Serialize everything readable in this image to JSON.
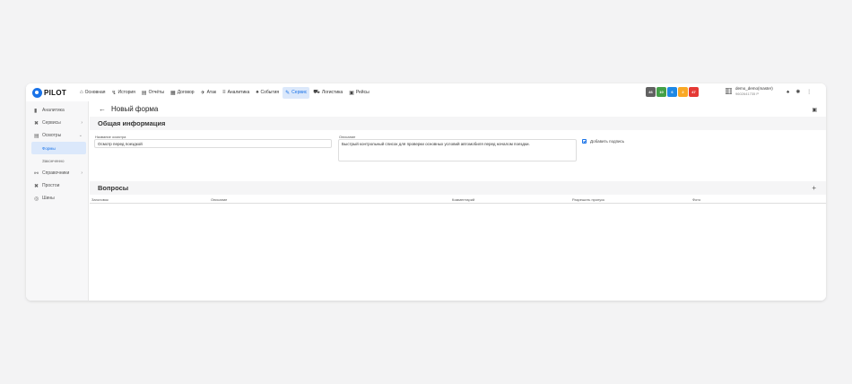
{
  "app": {
    "logo_text": "PILOT"
  },
  "nav": [
    {
      "label": "Основная",
      "icon": "home-icon",
      "glyph": "⌂",
      "active": false
    },
    {
      "label": "История",
      "icon": "history-icon",
      "glyph": "↯",
      "active": false
    },
    {
      "label": "Отчёты",
      "icon": "report-icon",
      "glyph": "▤",
      "active": false
    },
    {
      "label": "Договор",
      "icon": "contract-icon",
      "glyph": "▦",
      "active": false
    },
    {
      "label": "Атак",
      "icon": "attack-icon",
      "glyph": "✈",
      "active": false
    },
    {
      "label": "Аналитика",
      "icon": "analytics-icon",
      "glyph": "≡",
      "active": false
    },
    {
      "label": "События",
      "icon": "bell-icon",
      "glyph": "♠",
      "active": false
    },
    {
      "label": "Сервис",
      "icon": "wrench-icon",
      "glyph": "✎",
      "active": true
    },
    {
      "label": "Логистика",
      "icon": "truck-icon",
      "glyph": "⛟",
      "active": false
    },
    {
      "label": "Рейсы",
      "icon": "bus-icon",
      "glyph": "▣",
      "active": false
    }
  ],
  "badges": [
    {
      "value": "46",
      "color": "#616161"
    },
    {
      "value": "10",
      "color": "#43a047"
    },
    {
      "value": "6",
      "color": "#1e88e5"
    },
    {
      "value": "2",
      "color": "#f9a825"
    },
    {
      "value": "47",
      "color": "#e53935"
    }
  ],
  "user": {
    "name": "demo_demo(master)",
    "id": "9602641735 P"
  },
  "sidebar": {
    "items": [
      {
        "label": "Аналитика",
        "icon": "chart-icon",
        "glyph": "▮",
        "chevron": ""
      },
      {
        "label": "Сервисы",
        "icon": "tools-icon",
        "glyph": "✖",
        "chevron": "›"
      },
      {
        "label": "Осмотры",
        "icon": "document-icon",
        "glyph": "▤",
        "chevron": "⌄"
      }
    ],
    "sub": [
      {
        "label": "Формы",
        "active": true
      },
      {
        "label": "Законченно",
        "active": false
      }
    ],
    "items2": [
      {
        "label": "Справочники",
        "icon": "directory-icon",
        "glyph": "⚯",
        "chevron": "›"
      },
      {
        "label": "Простои",
        "icon": "downtime-icon",
        "glyph": "✖",
        "chevron": ""
      },
      {
        "label": "Шины",
        "icon": "tire-icon",
        "glyph": "◎",
        "chevron": ""
      }
    ]
  },
  "page": {
    "title": "Новый форма"
  },
  "general": {
    "title": "Общая информация",
    "name_label": "Название осмотра",
    "name_value": "Осмотр перед поездкой",
    "desc_label": "Описание",
    "desc_value": "Быстрый контрольный список для проверки основных условий автомобиля перед началом поездки.",
    "signature_label": "Добавить подпись"
  },
  "questions": {
    "title": "Вопросы",
    "columns": [
      "Заголовок",
      "Описание",
      "Комментарий",
      "Разрешить пропуск",
      "Фото"
    ]
  }
}
